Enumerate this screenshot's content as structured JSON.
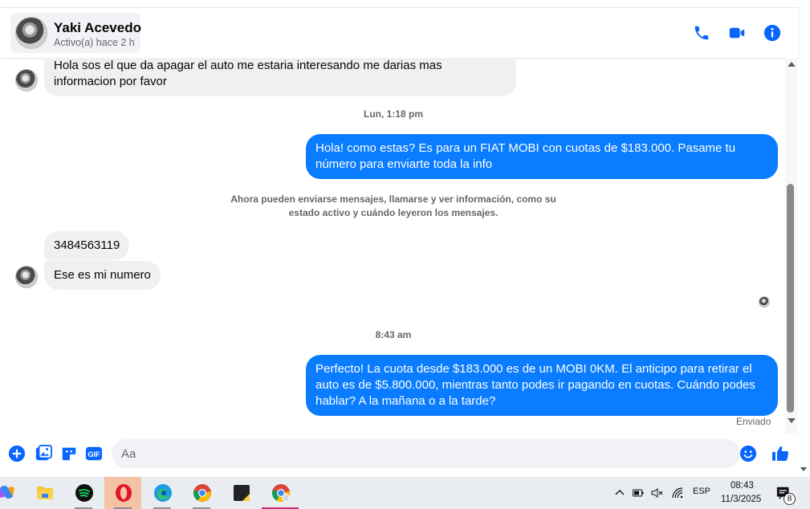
{
  "header": {
    "contact_name": "Yaki Acevedo",
    "contact_status": "Activo(a) hace 2 h",
    "icons": [
      "phone-icon",
      "video-icon",
      "info-icon"
    ]
  },
  "thread": {
    "messages": [
      {
        "direction": "incoming",
        "text": "Hola sos el que da apagar el auto me estaria interesando me darias mas informacion por favor"
      },
      {
        "type": "timestamp",
        "text": "Lun, 1:18 pm"
      },
      {
        "direction": "outgoing",
        "text": "Hola! como estas? Es para un FIAT MOBI con cuotas de $183.000. Pasame tu número para enviarte toda la info"
      },
      {
        "type": "notice",
        "text": "Ahora pueden enviarse mensajes, llamarse y ver información, como su estado activo y cuándo leyeron los mensajes."
      },
      {
        "direction": "incoming",
        "text": "3484563119"
      },
      {
        "direction": "incoming",
        "text": "Ese es mi numero"
      },
      {
        "type": "timestamp",
        "text": "8:43 am"
      },
      {
        "direction": "outgoing",
        "text": "Perfecto! La cuota desde $183.000 es de un MOBI 0KM. El anticipo para retirar el auto es de $5.800.000, mientras tanto podes ir pagando en cuotas. Cuándo podes hablar? A la mañana o a la tarde?"
      }
    ],
    "delivery_status": "Enviado"
  },
  "composer": {
    "placeholder": "Aa",
    "gif_label": "GIF"
  },
  "taskbar": {
    "language": "ESP",
    "time": "08:43",
    "date": "11/3/2025",
    "notification_count": "8",
    "apps": [
      "copilot-icon",
      "file-explorer-icon",
      "spotify-icon",
      "opera-icon",
      "edge-icon",
      "chrome-icon",
      "sticky-notes-icon",
      "chrome-profile-icon"
    ]
  },
  "colors": {
    "messenger_blue": "#0a7cff",
    "incoming_bubble": "#f0f0f0",
    "accent_icon": "#0866ff"
  }
}
